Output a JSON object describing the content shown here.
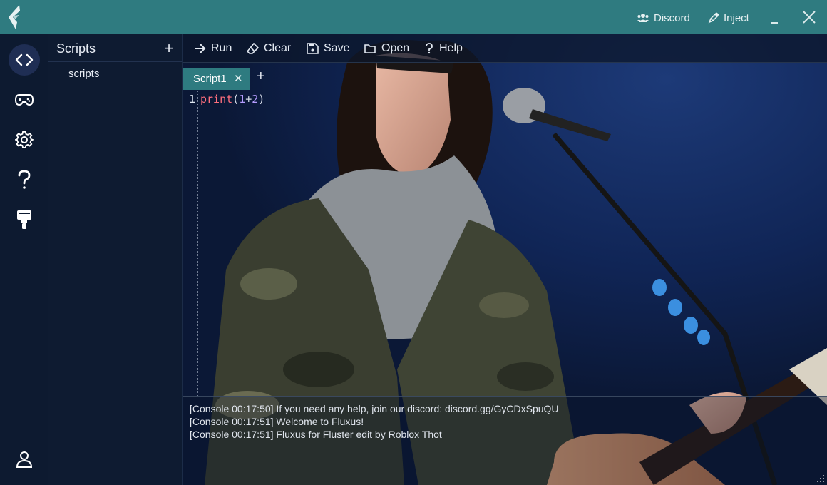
{
  "titlebar": {
    "discord_label": "Discord",
    "inject_label": "Inject"
  },
  "sidebar": {
    "items": [
      {
        "icon": "code-icon",
        "active": true
      },
      {
        "icon": "gamepad-icon",
        "active": false
      },
      {
        "icon": "gear-icon",
        "active": false
      },
      {
        "icon": "help-icon",
        "active": false
      },
      {
        "icon": "paint-brush-icon",
        "active": false
      },
      {
        "icon": "user-icon",
        "active": false
      }
    ]
  },
  "scripts_panel": {
    "title": "Scripts",
    "items": [
      "scripts"
    ]
  },
  "toolbar": {
    "run_label": "Run",
    "clear_label": "Clear",
    "save_label": "Save",
    "open_label": "Open",
    "help_label": "Help"
  },
  "tabs": [
    {
      "label": "Script1",
      "active": true
    }
  ],
  "editor": {
    "line_number": "1",
    "code_keyword": "print",
    "code_open": "(",
    "code_num1": "1",
    "code_op": "+",
    "code_num2": "2",
    "code_close": ")"
  },
  "console": {
    "lines": [
      "[Console 00:17:50] If you need any help, join our discord: discord.gg/GyCDxSpuQU",
      "[Console 00:17:51] Welcome to Fluxus!",
      "[Console 00:17:51] Fluxus for Fluster edit by Roblox Thot"
    ]
  },
  "colors": {
    "titlebar": "#2f7b80",
    "rail": "#0d1a30",
    "panel": "#0e1b31",
    "tab_active": "#2e7b80",
    "keyword": "#ff6f7e",
    "number": "#b69cff"
  }
}
